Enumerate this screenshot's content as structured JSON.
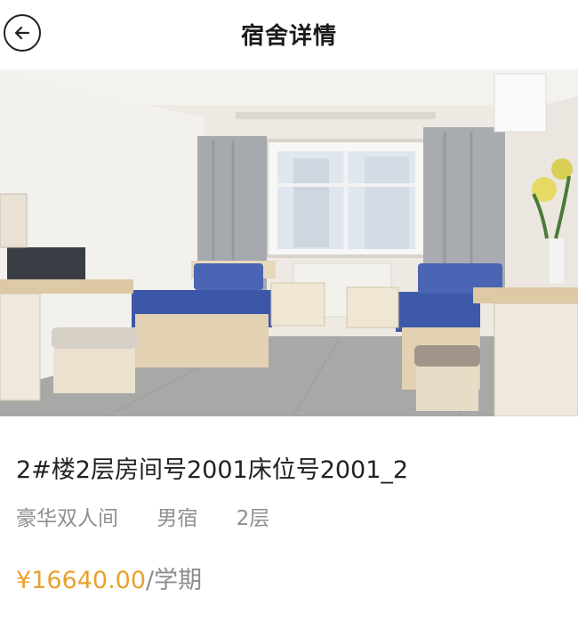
{
  "header": {
    "title": "宿舍详情",
    "back_icon": "back-arrow-icon"
  },
  "room": {
    "photo_icon": "dorm-room-photo",
    "title": "2#楼2层房间号2001床位号2001_2",
    "tags": [
      "豪华双人间",
      "男宿",
      "2层"
    ],
    "price": "¥16640.00",
    "price_unit": "/学期"
  },
  "colors": {
    "price": "#e8a230",
    "tag_text": "#8f8f8f",
    "title_text": "#222222"
  }
}
